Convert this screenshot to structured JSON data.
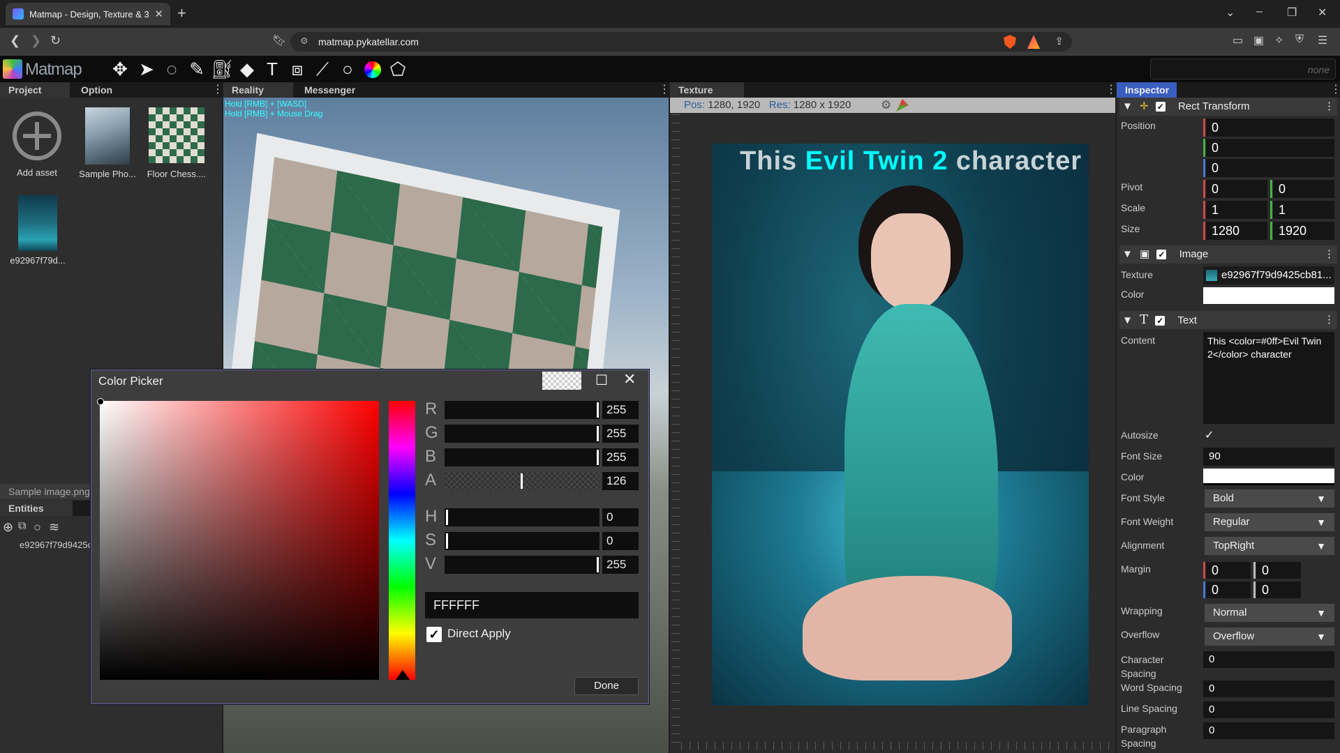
{
  "browser": {
    "tab_title": "Matmap - Design, Texture & 3D",
    "url": "matmap.pykatellar.com"
  },
  "app": {
    "name": "Matmap",
    "search_placeholder": "none"
  },
  "left_panel": {
    "tabs": [
      "Project",
      "Option"
    ],
    "assets": [
      {
        "label": "Add asset"
      },
      {
        "label": "Sample Pho..."
      },
      {
        "label": "Floor Chess...."
      },
      {
        "label": "e92967f79d..."
      }
    ],
    "selected_file": "Sample image.png",
    "entities_tab": "Entities",
    "entity_item": "e92967f79d9425c"
  },
  "viewport": {
    "tabs": [
      "Reality",
      "Messenger"
    ],
    "hint1": "Hold [RMB] + [WASD]",
    "hint2": "Hold [RMB] + Mouse Drag"
  },
  "texture": {
    "tab": "Texture",
    "pos_label": "Pos:",
    "pos_value": "1280, 1920",
    "res_label": "Res:",
    "res_value": "1280 x 1920",
    "overlay_before": "This ",
    "overlay_colored": "Evil Twin 2",
    "overlay_after": " character",
    "overlay_color": "#00ffff"
  },
  "inspector": {
    "tab": "Inspector",
    "rect_transform": {
      "title": "Rect Transform",
      "position_label": "Position",
      "position": [
        "0",
        "0",
        "0"
      ],
      "pivot_label": "Pivot",
      "pivot": [
        "0",
        "0"
      ],
      "scale_label": "Scale",
      "scale": [
        "1",
        "1"
      ],
      "size_label": "Size",
      "size": [
        "1280",
        "1920"
      ]
    },
    "image": {
      "title": "Image",
      "texture_label": "Texture",
      "texture_value": "e92967f79d9425cb81...",
      "color_label": "Color"
    },
    "text": {
      "title": "Text",
      "content_label": "Content",
      "content_value": "This <color=#0ff>Evil Twin 2</color> character",
      "autosize_label": "Autosize",
      "font_size_label": "Font Size",
      "font_size": "90",
      "color_label": "Color",
      "font_style_label": "Font Style",
      "font_style": "Bold",
      "font_weight_label": "Font Weight",
      "font_weight": "Regular",
      "alignment_label": "Alignment",
      "alignment": "TopRight",
      "margin_label": "Margin",
      "margin": [
        "0",
        "0",
        "0",
        "0"
      ],
      "wrapping_label": "Wrapping",
      "wrapping": "Normal",
      "overflow_label": "Overflow",
      "overflow": "Overflow",
      "char_spacing_label_1": "Character",
      "char_spacing_label_2": "Spacing",
      "char_spacing": "0",
      "word_spacing_label": "Word Spacing",
      "word_spacing": "0",
      "line_spacing_label": "Line Spacing",
      "line_spacing": "0",
      "para_spacing_label_1": "Paragraph",
      "para_spacing_label_2": "Spacing",
      "para_spacing": "0"
    }
  },
  "color_picker": {
    "title": "Color Picker",
    "r_label": "R",
    "r": "255",
    "g_label": "G",
    "g": "255",
    "b_label": "B",
    "b": "255",
    "a_label": "A",
    "a": "126",
    "h_label": "H",
    "h": "0",
    "s_label": "S",
    "s": "0",
    "v_label": "V",
    "v": "255",
    "hex": "FFFFFF",
    "direct_apply": "Direct Apply",
    "done": "Done"
  }
}
